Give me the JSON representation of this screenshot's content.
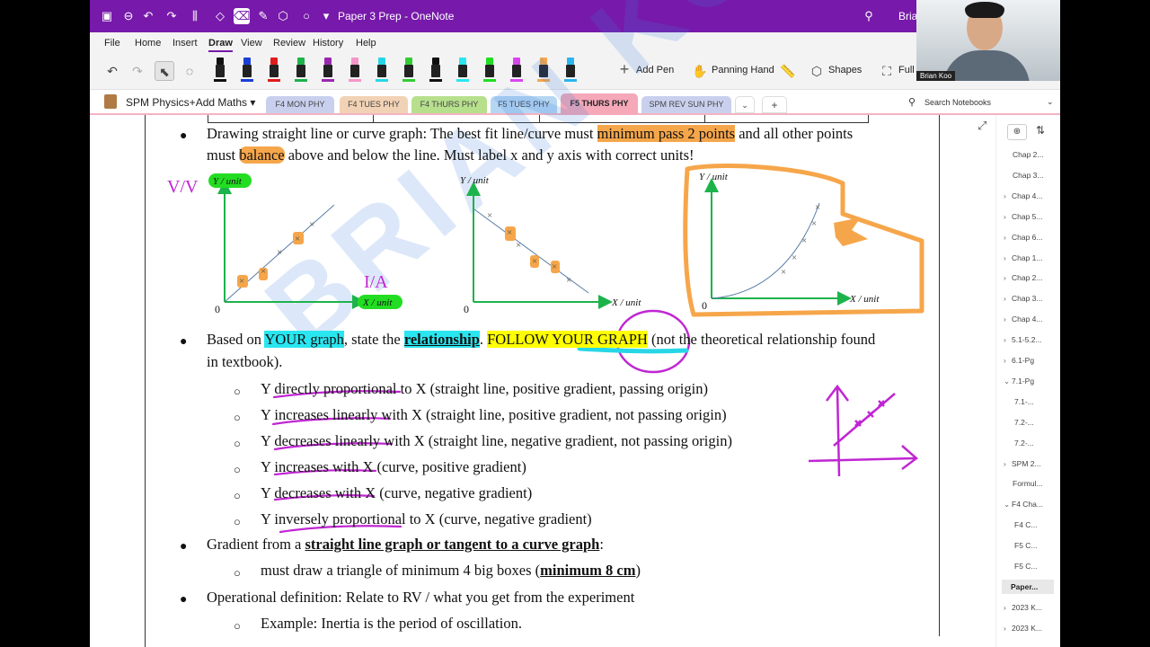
{
  "title_bar": {
    "document": "Paper 3 Prep",
    "app": "OneNote",
    "separator": "-",
    "user_name": "Brian"
  },
  "menu": [
    "File",
    "Home",
    "Insert",
    "Draw",
    "View",
    "Review",
    "History",
    "Help"
  ],
  "menu_active": "Draw",
  "ribbon": {
    "add_pen": "Add Pen",
    "panning_hand": "Panning Hand",
    "shapes": "Shapes",
    "full": "Full",
    "pen_colors": [
      "#111111",
      "#1b3fd6",
      "#e01b1b",
      "#1db34b",
      "#9b27b0",
      "#f596c8",
      "#27d6e6",
      "#33cc33",
      "#111111",
      "#29e6f0",
      "#22dd22",
      "#d946ef",
      "#f6a64a",
      "#29b6f0"
    ]
  },
  "notebook": {
    "name": "SPM Physics+Add Maths",
    "tabs": [
      {
        "label": "F4 MON PHY",
        "color": "#c9d0ee"
      },
      {
        "label": "F4 TUES PHY",
        "color": "#f2d2b5"
      },
      {
        "label": "F4 THURS PHY",
        "color": "#b7e08d"
      },
      {
        "label": "F5 TUES PHY",
        "color": "#b6d7f3"
      },
      {
        "label": "F5 THURS PHY",
        "color": "#f5a8b8"
      },
      {
        "label": "SPM REV SUN PHY",
        "color": "#c9d0ee"
      }
    ],
    "active_tab": "F5 THURS PHY",
    "search_placeholder": "Search Notebooks",
    "add_tab": "+"
  },
  "sidebar_pages": [
    {
      "label": "Chap 2...",
      "caret": ""
    },
    {
      "label": "Chap 3...",
      "caret": ""
    },
    {
      "label": "Chap 4...",
      "caret": "›"
    },
    {
      "label": "Chap 5...",
      "caret": "›"
    },
    {
      "label": "Chap 6...",
      "caret": "›"
    },
    {
      "label": "Chap 1...",
      "caret": "›"
    },
    {
      "label": "Chap 2...",
      "caret": "›"
    },
    {
      "label": "Chap 3...",
      "caret": "›"
    },
    {
      "label": "Chap 4...",
      "caret": "›"
    },
    {
      "label": "5.1-5.2...",
      "caret": "›"
    },
    {
      "label": "6.1-Pg",
      "caret": "›"
    },
    {
      "label": "7.1-Pg",
      "caret": "⌄"
    },
    {
      "label": "7.1-...",
      "caret": ""
    },
    {
      "label": "7.2-...",
      "caret": ""
    },
    {
      "label": "7.2-...",
      "caret": ""
    },
    {
      "label": "SPM 2...",
      "caret": "›"
    },
    {
      "label": "Formul...",
      "caret": ""
    },
    {
      "label": "F4 Cha...",
      "caret": "⌄"
    },
    {
      "label": "F4 C...",
      "caret": ""
    },
    {
      "label": "F5 C...",
      "caret": ""
    },
    {
      "label": "F5 C...",
      "caret": ""
    },
    {
      "label": "Paper...",
      "caret": ""
    },
    {
      "label": "2023 K...",
      "caret": "›"
    },
    {
      "label": "2023 K...",
      "caret": "›"
    }
  ],
  "selected_page": "Paper...",
  "content": {
    "bullet1_a": "Drawing straight line or curve graph: The best fit line/curve must ",
    "bullet1_hl": "minimum pass 2 points",
    "bullet1_b": " and all other points",
    "bullet1_c": "must ",
    "bullet1_hl2": "balance",
    "bullet1_d": " above and below the line. Must label x and y axis with correct units!",
    "graphs": {
      "y_axis": "Y / unit",
      "x_axis": "X / unit",
      "origin": "0"
    },
    "bullet2_a": "Based on ",
    "bullet2_hl": "YOUR graph",
    "bullet2_b": ", state the ",
    "bullet2_rel": "relationship",
    "bullet2_c": ". ",
    "bullet2_follow": "FOLLOW YOUR GRAPH",
    "bullet2_d": " (not the theoretical relationship found",
    "bullet2_e": "in textbook).",
    "relationships": [
      "Y directly proportional to X (straight line, positive gradient, passing origin)",
      "Y increases linearly with X (straight line, positive gradient, not passing origin)",
      "Y decreases linearly with X (straight line, negative gradient, not passing origin)",
      "Y increases with X (curve, positive gradient)",
      "Y decreases with X (curve, negative gradient)",
      "Y inversely proportional to X (curve, negative gradient)"
    ],
    "bullet3_a": "Gradient from a ",
    "bullet3_ub": "straight line graph or tangent to a curve graph",
    "bullet3_b": ":",
    "bullet3_sub_a": "must draw a triangle of minimum 4 big boxes (",
    "bullet3_sub_ub": "minimum 8 cm",
    "bullet3_sub_b": ")",
    "bullet4": "Operational definition: Relate to RV / what you get from the experiment",
    "bullet4_sub": "Example: Inertia is the period of oscillation.",
    "ink_vv": "V/V",
    "ink_ia": "I/A",
    "watermark": "BRIAN KOO"
  },
  "webcam_label": "Brian Koo"
}
